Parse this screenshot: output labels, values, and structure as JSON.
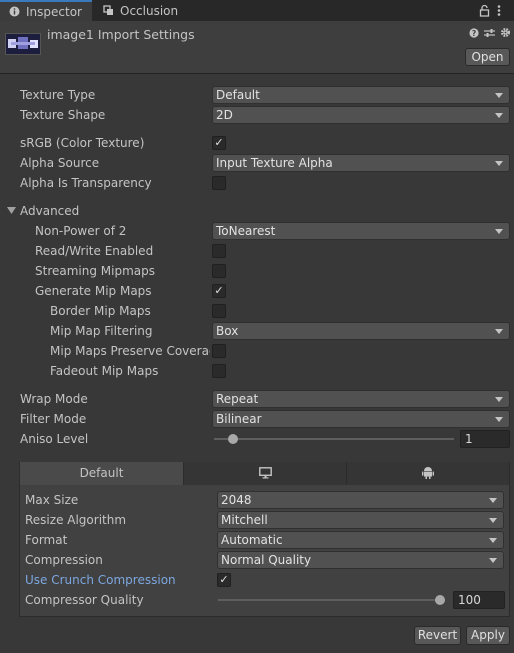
{
  "tabs": [
    {
      "label": "Inspector",
      "icon": "info-icon"
    },
    {
      "label": "Occlusion",
      "icon": "occlusion-icon"
    }
  ],
  "header": {
    "title": "image1 Import Settings",
    "open_label": "Open",
    "icons": [
      "help-icon",
      "presets-icon",
      "gear-icon"
    ]
  },
  "settings": {
    "texture_type": {
      "label": "Texture Type",
      "value": "Default"
    },
    "texture_shape": {
      "label": "Texture Shape",
      "value": "2D"
    },
    "srgb": {
      "label": "sRGB (Color Texture)",
      "checked": true
    },
    "alpha_source": {
      "label": "Alpha Source",
      "value": "Input Texture Alpha"
    },
    "alpha_transparency": {
      "label": "Alpha Is Transparency",
      "checked": false
    },
    "advanced": {
      "label": "Advanced",
      "non_power_of_2": {
        "label": "Non-Power of 2",
        "value": "ToNearest"
      },
      "read_write": {
        "label": "Read/Write Enabled",
        "checked": false
      },
      "streaming_mipmaps": {
        "label": "Streaming Mipmaps",
        "checked": false
      },
      "generate_mip_maps": {
        "label": "Generate Mip Maps",
        "checked": true
      },
      "border_mip_maps": {
        "label": "Border Mip Maps",
        "checked": false
      },
      "mip_map_filtering": {
        "label": "Mip Map Filtering",
        "value": "Box"
      },
      "mip_maps_preserve": {
        "label": "Mip Maps Preserve Coverag",
        "checked": false
      },
      "fadeout_mip_maps": {
        "label": "Fadeout Mip Maps",
        "checked": false
      }
    },
    "wrap_mode": {
      "label": "Wrap Mode",
      "value": "Repeat"
    },
    "filter_mode": {
      "label": "Filter Mode",
      "value": "Bilinear"
    },
    "aniso_level": {
      "label": "Aniso Level",
      "value": "1",
      "fraction": 0.06
    }
  },
  "platform": {
    "tabs": [
      {
        "label": "Default",
        "icon": ""
      },
      {
        "label": "",
        "icon": "monitor-icon"
      },
      {
        "label": "",
        "icon": "android-icon"
      }
    ],
    "max_size": {
      "label": "Max Size",
      "value": "2048"
    },
    "resize_algorithm": {
      "label": "Resize Algorithm",
      "value": "Mitchell"
    },
    "format": {
      "label": "Format",
      "value": "Automatic"
    },
    "compression": {
      "label": "Compression",
      "value": "Normal Quality"
    },
    "use_crunch": {
      "label": "Use Crunch Compression",
      "checked": true
    },
    "compressor_quality": {
      "label": "Compressor Quality",
      "value": "100",
      "fraction": 1.0
    }
  },
  "footer": {
    "revert_label": "Revert",
    "apply_label": "Apply"
  },
  "check_glyph": "✓"
}
